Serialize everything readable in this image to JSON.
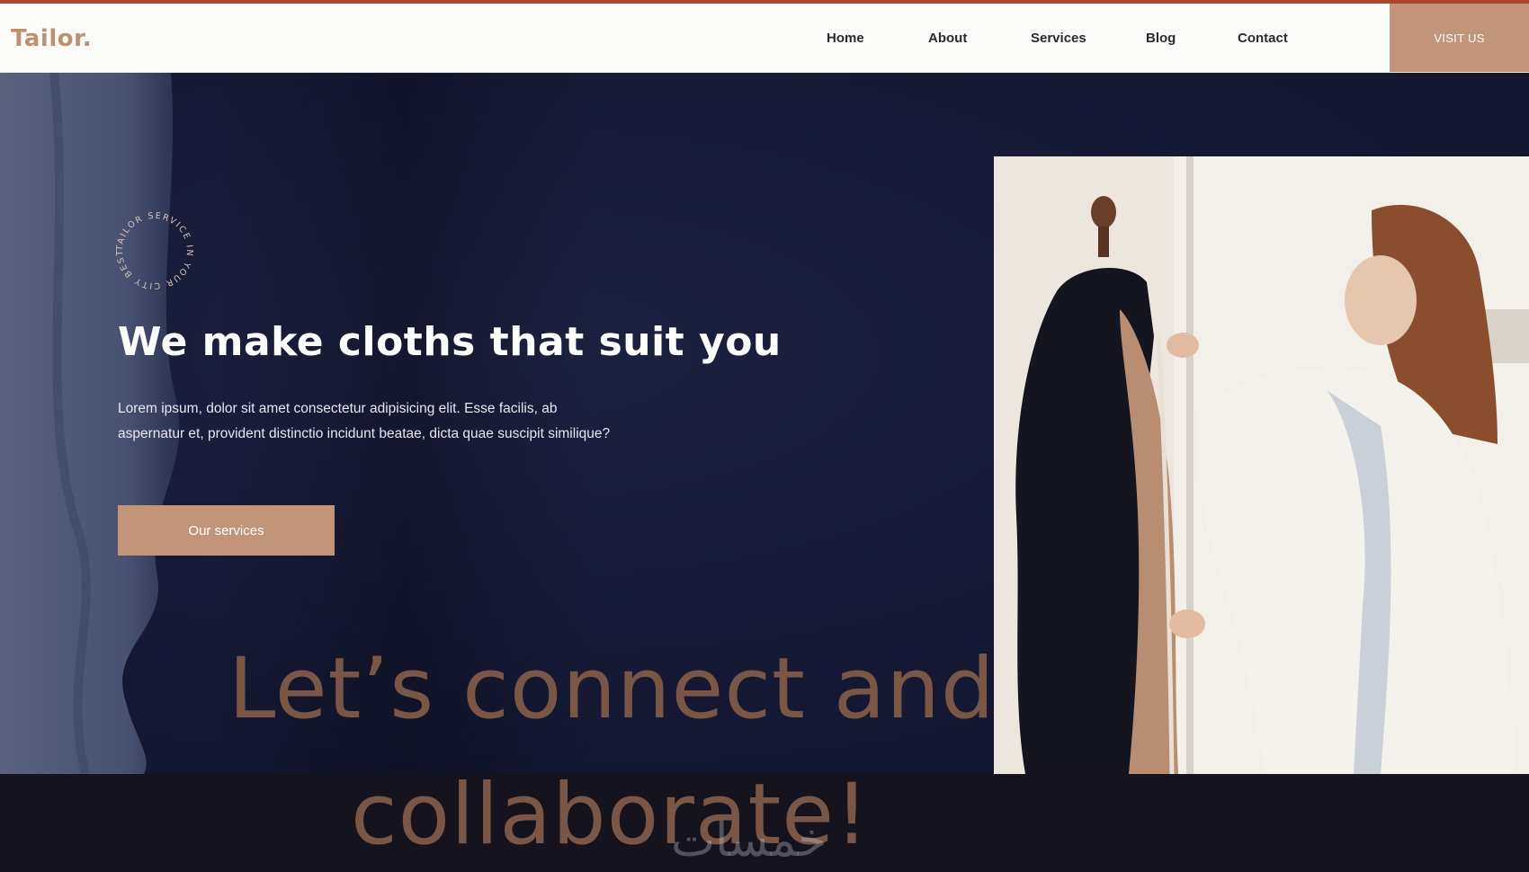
{
  "brand": {
    "name": "Tailor",
    "dot": "."
  },
  "nav": {
    "items": [
      "Home",
      "About",
      "Services",
      "Blog",
      "Contact"
    ],
    "cta": "VISIT US"
  },
  "badge": {
    "text": "TAILOR SERVICE IN YOUR CITY BEST",
    "icon": "circular-text-badge"
  },
  "hero": {
    "title": "We make cloths that suit you",
    "text": "Lorem ipsum, dolor sit amet consectetur adipisicing elit. Esse facilis, ab aspernatur et, provident distinctio incidunt beatae, dicta quae suscipit similique?",
    "cta": "Our services"
  },
  "overlay": {
    "line1": "Let’s connect and",
    "line2": "collaborate!"
  },
  "watermark": "خمسات",
  "colors": {
    "accent": "#c29478",
    "topline": "#a8452c",
    "hero_bg": "#141833",
    "overlay_text": "#7a5646"
  }
}
